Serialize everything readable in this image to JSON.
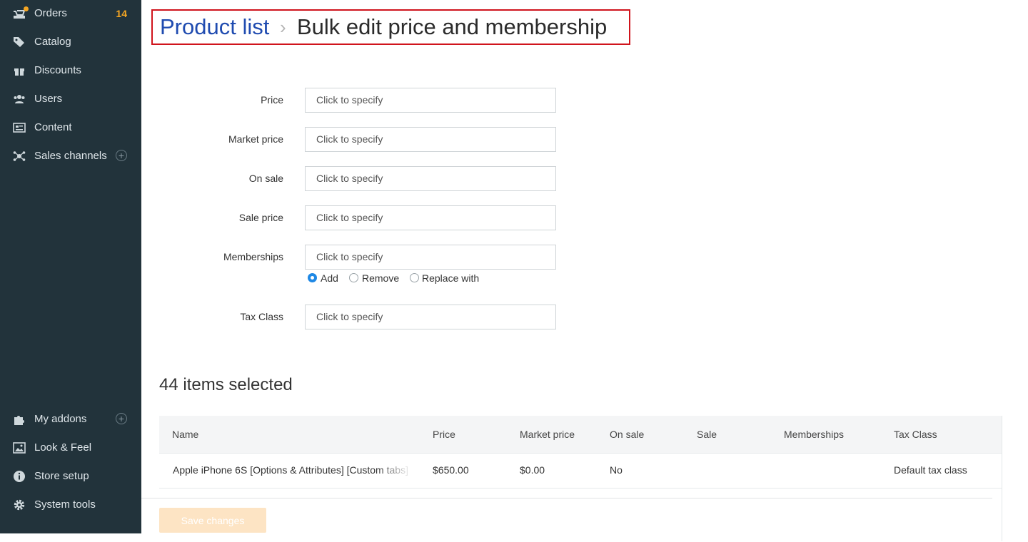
{
  "sidebar": {
    "items": [
      {
        "label": "Orders",
        "icon": "orders-icon",
        "count": "14"
      },
      {
        "label": "Catalog",
        "icon": "tag-icon"
      },
      {
        "label": "Discounts",
        "icon": "gift-icon"
      },
      {
        "label": "Users",
        "icon": "users-icon"
      },
      {
        "label": "Content",
        "icon": "content-icon"
      },
      {
        "label": "Sales channels",
        "icon": "network-icon",
        "plus": "+"
      }
    ],
    "bottom_items": [
      {
        "label": "My addons",
        "icon": "puzzle-icon",
        "plus": "+"
      },
      {
        "label": "Look & Feel",
        "icon": "image-icon"
      },
      {
        "label": "Store setup",
        "icon": "info-icon"
      },
      {
        "label": "System tools",
        "icon": "gear-icon"
      }
    ],
    "colors": {
      "background": "#22333b",
      "count": "#f5a623",
      "text": "#dfe6ea"
    }
  },
  "header": {
    "breadcrumb_link": "Product list",
    "separator": "›",
    "title": "Bulk edit price and membership"
  },
  "form": {
    "fields": [
      {
        "label": "Price",
        "placeholder": "Click to specify"
      },
      {
        "label": "Market price",
        "placeholder": "Click to specify"
      },
      {
        "label": "On sale",
        "placeholder": "Click to specify"
      },
      {
        "label": "Sale price",
        "placeholder": "Click to specify"
      },
      {
        "label": "Memberships",
        "placeholder": "Click to specify"
      },
      {
        "label": "Tax Class",
        "placeholder": "Click to specify"
      }
    ],
    "membership_mode": {
      "options": [
        "Add",
        "Remove",
        "Replace with"
      ],
      "selected": "Add"
    }
  },
  "items": {
    "heading": "44 items selected",
    "columns": [
      "Name",
      "Price",
      "Market price",
      "On sale",
      "Sale",
      "Memberships",
      "Tax Class"
    ],
    "rows": [
      {
        "name": "Apple iPhone 6S [Options & Attributes] [Custom tabs]",
        "price": "$650.00",
        "market_price": "$0.00",
        "on_sale": "No",
        "sale": "",
        "memberships": "",
        "tax_class": "Default tax class"
      }
    ]
  },
  "footer": {
    "save_label": "Save changes",
    "save_color": "#fde4c4"
  },
  "colors": {
    "accent": "#1e88e5",
    "link": "#1f4bb0",
    "highlight_border": "#d0141c"
  }
}
